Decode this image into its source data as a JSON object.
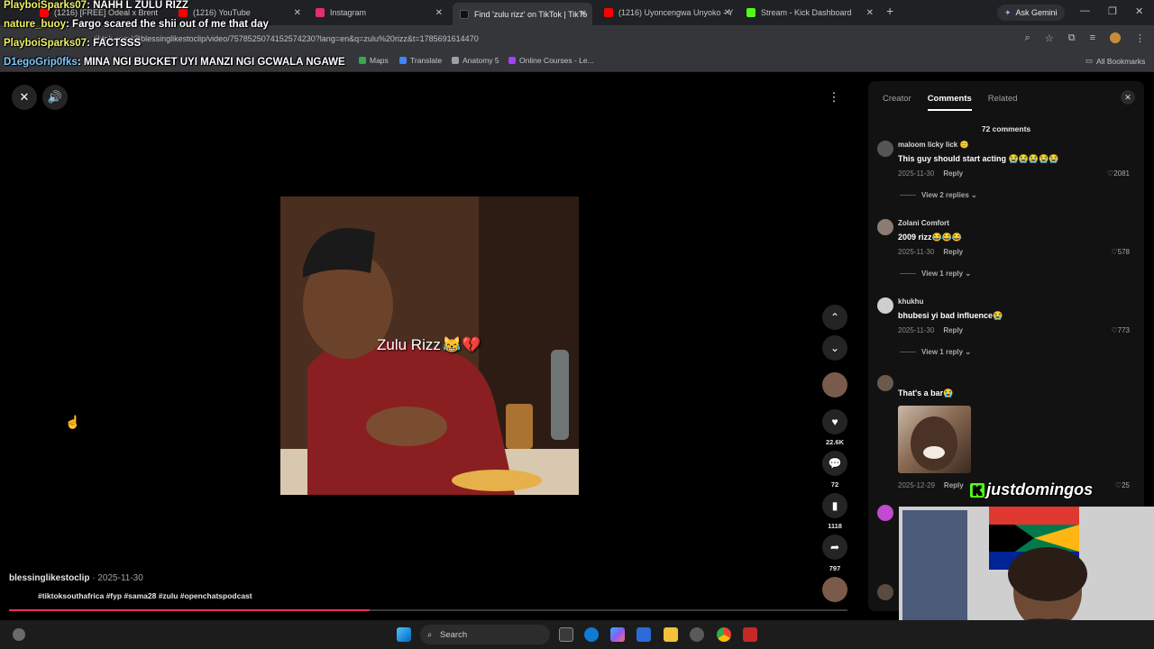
{
  "browser": {
    "tabs": [
      {
        "title": "(1216) [FREE] Odeal x Brent Fa",
        "icon_color": "#ff0000"
      },
      {
        "title": "(1216) YouTube",
        "icon_color": "#ff0000"
      },
      {
        "title": "Instagram",
        "icon_color": "#e1306c"
      },
      {
        "title": "Find 'zulu rizz' on TikTok | TikTo",
        "icon_color": "#111111",
        "active": true
      },
      {
        "title": "(1216) Uyoncengwa Unyoko - Y",
        "icon_color": "#ff0000"
      },
      {
        "title": "Stream - Kick Dashboard",
        "icon_color": "#53fc18"
      }
    ],
    "new_tab_icon": "plus-icon",
    "ask_gemini": "Ask Gemini",
    "url": "tiktok.com/@blessinglikestoclip/video/7578525074152574230?lang=en&q=zulu%20rizz&t=1785691614470",
    "bookmarks": [
      "Maps",
      "Translate",
      "Anatomy 5",
      "Online Courses - Le..."
    ],
    "all_bookmarks": "All Bookmarks"
  },
  "chat_overlay": [
    {
      "user": "PlayboiSparks07",
      "message": ": NAHH L ZULU RIZZ"
    },
    {
      "user": "nature_buoy",
      "message": ": Fargo scared the shii out of me that day"
    },
    {
      "user": "PlayboiSparks07",
      "message": ": FACTSSS"
    },
    {
      "user": "D1egoGrip0fks",
      "message": ": MINA NGI BUCKET UYI MANZI NGI GCWALA NGAWE"
    }
  ],
  "video": {
    "caption": "Zulu Rizz",
    "caption_emoji": "😹💔",
    "author": "blessinglikestoclip",
    "date": "2025-11-30",
    "hashtags": "#tiktoksouthafrica #fyp #sama28 #zulu #openchatspodcast",
    "progress_fraction": 0.43,
    "counts": {
      "likes": "22.6K",
      "comments": "72",
      "saves": "1118",
      "shares": "797"
    }
  },
  "panel": {
    "tabs": [
      "Creator",
      "Comments",
      "Related"
    ],
    "active_tab": "Comments",
    "comment_count": "72 comments",
    "comments": [
      {
        "name": "maloom licky lick 🙂",
        "text": "This guy should start acting 😭😭😭😭😭",
        "date": "2025-11-30",
        "reply": "Reply",
        "likes": "2081",
        "view_replies": "View 2 replies",
        "avatar_color": "#555555"
      },
      {
        "name": "Zolani Comfort",
        "text": "2009 rizz😂😂😂",
        "date": "2025-11-30",
        "reply": "Reply",
        "likes": "578",
        "view_replies": "View 1 reply",
        "avatar_color": "#8a7c73"
      },
      {
        "name": "khukhu",
        "text": "bhubesi yi bad influence😭",
        "date": "2025-11-30",
        "reply": "Reply",
        "likes": "773",
        "view_replies": "View 1 reply",
        "avatar_color": "#cfcfcf"
      },
      {
        "name": "",
        "text": "That's a bar😭",
        "date": "2025-12-29",
        "reply": "Reply",
        "likes": "25",
        "view_replies": "",
        "avatar_color": "#6b5a4c"
      }
    ]
  },
  "stream": {
    "kick_username": "justdomingos"
  },
  "taskbar": {
    "search": "Search"
  }
}
